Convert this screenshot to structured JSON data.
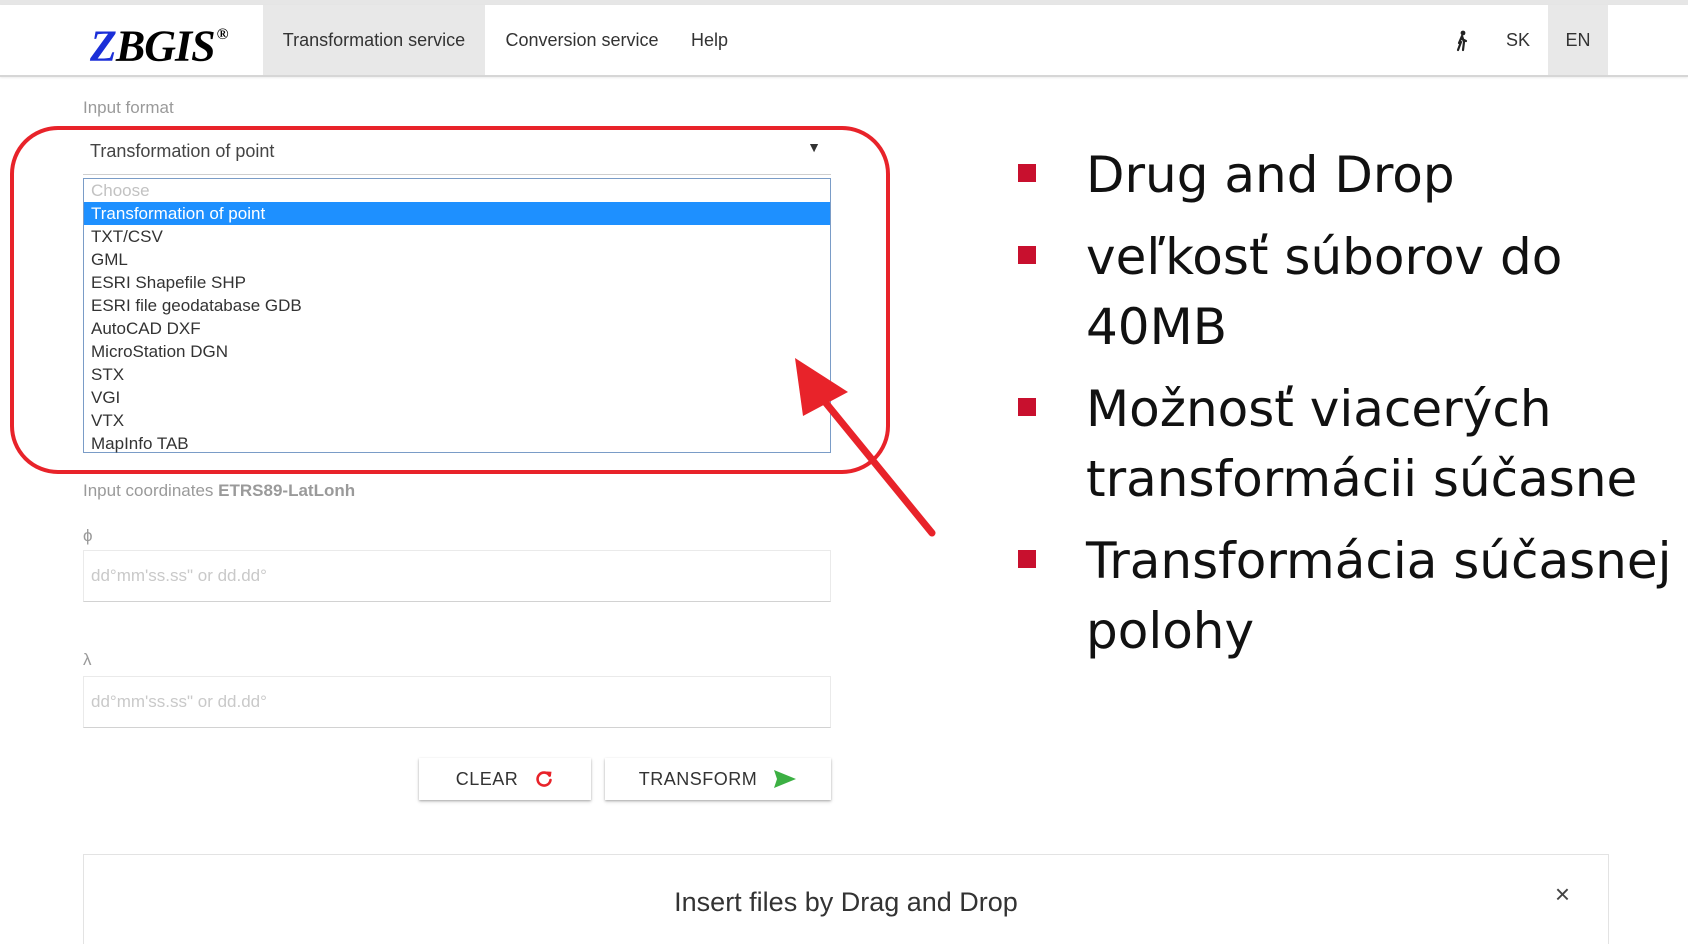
{
  "header": {
    "logo_text": "ZBGIS",
    "logo_first_letter": "Z",
    "logo_rest": "BGIS",
    "logo_mark": "®",
    "nav": [
      {
        "label": "Transformation service",
        "active": true
      },
      {
        "label": "Conversion service",
        "active": false
      },
      {
        "label": "Help",
        "active": false
      }
    ],
    "accessibility_icon": "person-walking-icon",
    "lang": [
      {
        "label": "SK",
        "active": false
      },
      {
        "label": "EN",
        "active": true
      }
    ]
  },
  "form": {
    "input_format_label": "Input format",
    "selected_value": "Transformation of point",
    "options": [
      "Choose",
      "Transformation of point",
      "TXT/CSV",
      "GML",
      "ESRI Shapefile SHP",
      "ESRI file geodatabase GDB",
      "AutoCAD DXF",
      "MicroStation DGN",
      "STX",
      "VGI",
      "VTX",
      "MapInfo TAB"
    ],
    "coords_label": "Input coordinates",
    "coords_system": "ETRS89-LatLonh",
    "phi_label": "ϕ",
    "phi_placeholder": "dd°mm'ss.ss\" or dd.dd°",
    "lambda_label": "λ",
    "lambda_placeholder": "dd°mm'ss.ss\" or dd.dd°",
    "clear_label": "CLEAR",
    "transform_label": "TRANSFORM"
  },
  "dropzone": {
    "title": "Insert files by Drag and Drop",
    "close": "×"
  },
  "annotation": {
    "bullets": [
      "Drug and Drop",
      "veľkosť súborov do 40MB",
      "Možnosť viacerých transformácii súčasne",
      "Transformácia súčasnej polohy"
    ]
  },
  "colors": {
    "accent_red": "#e8232a",
    "bullet_red": "#c8102e",
    "selection_blue": "#1e90ff",
    "transform_green": "#3cb043",
    "logo_blue": "#1b2fd8"
  }
}
